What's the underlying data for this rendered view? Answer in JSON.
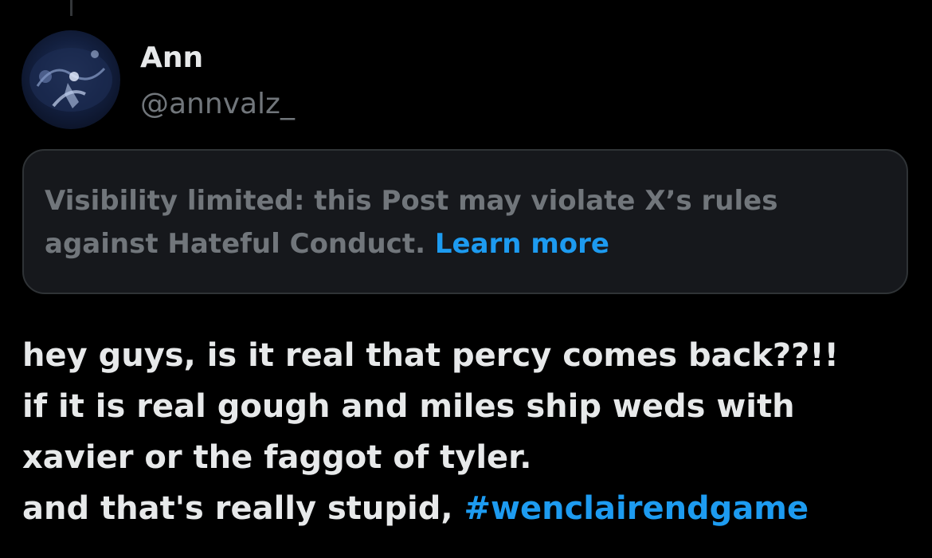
{
  "author": {
    "display_name": "Ann",
    "handle": "@annvalz_",
    "avatar_icon": "profile-photo"
  },
  "notice": {
    "text": "Visibility limited: this Post may violate X’s rules against Hateful Conduct.",
    "link_label": "Learn more"
  },
  "post": {
    "lines": [
      "hey guys, is it real that percy comes back??!!",
      "if it is real gough and miles ship weds with",
      "xavier or the faggot of tyler.",
      "and that's really stupid,"
    ],
    "hashtag": "#wenclairendgame"
  },
  "colors": {
    "background": "#000000",
    "text_primary": "#e7e9ea",
    "text_secondary": "#71767b",
    "link": "#1d9bf0",
    "notice_background": "#16181c",
    "notice_border": "#2f3336"
  }
}
